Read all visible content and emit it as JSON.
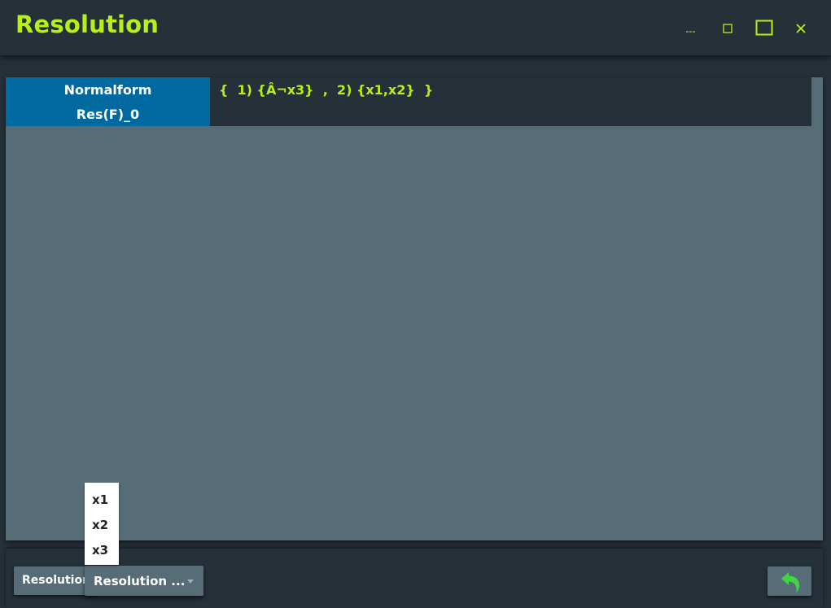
{
  "window": {
    "title": "Resolution",
    "controls": [
      "minimize-icon",
      "restore-icon",
      "maximize-icon",
      "close-icon"
    ],
    "accent_color": "#b6f018"
  },
  "resolution_table": {
    "label_line1": "Normalform",
    "label_line2": "Res(F)_0",
    "value": "{  1) {Â¬x3}  ,  2) {x1,x2}  }"
  },
  "bottom": {
    "resolution_button_label": "Resolution",
    "combo_selected": "Resolution ...",
    "dropdown_options": [
      "x1",
      "x2",
      "x3"
    ],
    "undo_icon": "undo-arrow-icon"
  },
  "colors": {
    "background": "#263039",
    "panel": "#566d78",
    "label_bg": "#006aa0",
    "accent": "#b6f018",
    "undo_arrow": "#3fd640"
  }
}
